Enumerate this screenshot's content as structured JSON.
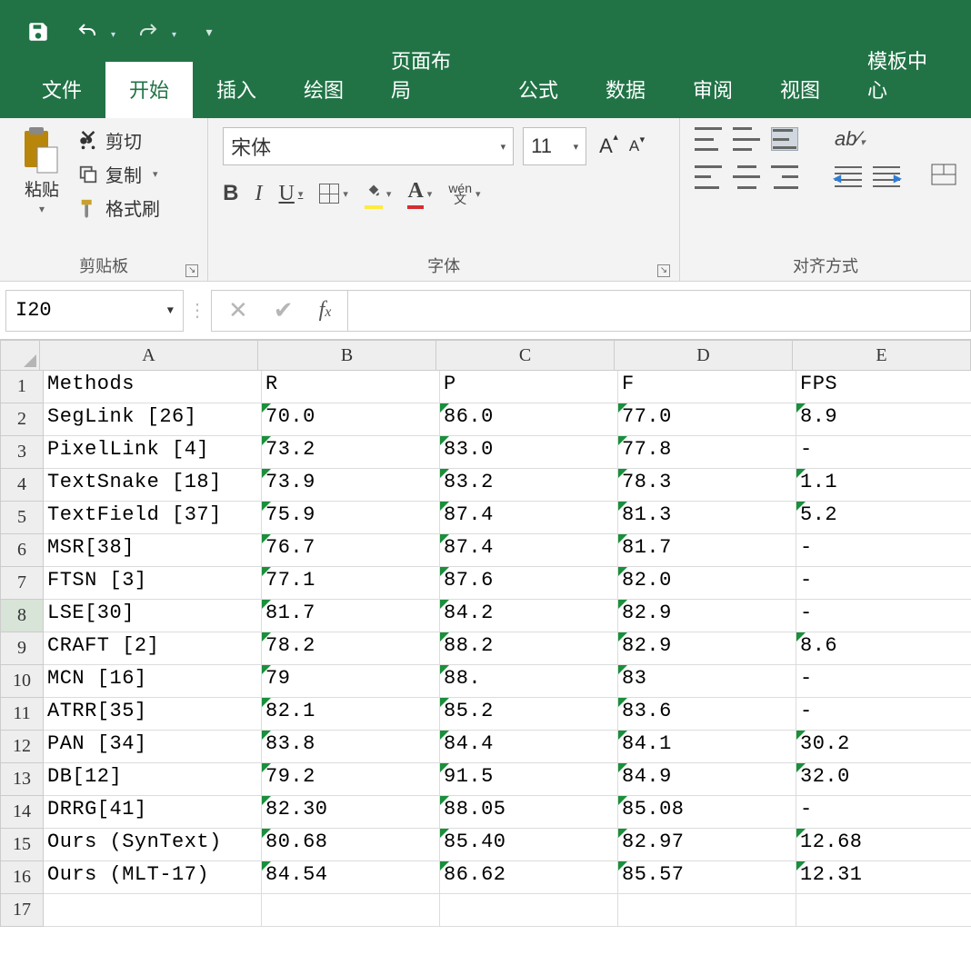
{
  "qat": {
    "save": "save",
    "undo": "undo",
    "redo": "redo"
  },
  "tabs": [
    "文件",
    "开始",
    "插入",
    "绘图",
    "页面布局",
    "公式",
    "数据",
    "审阅",
    "视图",
    "模板中心"
  ],
  "active_tab_index": 1,
  "ribbon": {
    "clipboard": {
      "label": "剪贴板",
      "paste": "粘贴",
      "cut": "剪切",
      "copy": "复制",
      "format_painter": "格式刷"
    },
    "font": {
      "label": "字体",
      "font_name": "宋体",
      "font_size": "11"
    },
    "align": {
      "label": "对齐方式"
    }
  },
  "name_box": "I20",
  "formula_value": "",
  "columns": [
    "A",
    "B",
    "C",
    "D",
    "E"
  ],
  "col_widths": [
    "cA",
    "cB",
    "cC",
    "cD",
    "cE"
  ],
  "row_count": 17,
  "selected_row": 8,
  "numeric_text_cols": [
    1,
    2,
    3,
    4
  ],
  "rows": [
    [
      "Methods",
      "R",
      "P",
      "F",
      "FPS"
    ],
    [
      "SegLink [26]",
      "70.0",
      "86.0",
      "77.0",
      "8.9"
    ],
    [
      "PixelLink [4]",
      "73.2",
      "83.0",
      "77.8",
      "-"
    ],
    [
      "TextSnake [18]",
      "73.9",
      "83.2",
      "78.3",
      "1.1"
    ],
    [
      "TextField [37]",
      "75.9",
      "87.4",
      "81.3",
      "5.2"
    ],
    [
      "MSR[38]",
      "76.7",
      "87.4",
      "81.7",
      "-"
    ],
    [
      "FTSN [3]",
      "77.1",
      "87.6",
      "82.0",
      "-"
    ],
    [
      "LSE[30]",
      "81.7",
      "84.2",
      "82.9",
      "-"
    ],
    [
      "CRAFT [2]",
      "78.2",
      "88.2",
      "82.9",
      "8.6"
    ],
    [
      "MCN [16]",
      "79",
      "88.",
      "83",
      "-"
    ],
    [
      "ATRR[35]",
      "82.1",
      "85.2",
      "83.6",
      "-"
    ],
    [
      "PAN [34]",
      "83.8",
      "84.4",
      "84.1",
      "30.2"
    ],
    [
      "DB[12]",
      "79.2",
      "91.5",
      "84.9",
      "32.0"
    ],
    [
      "DRRG[41]",
      "82.30",
      "88.05",
      "85.08",
      "-"
    ],
    [
      "Ours (SynText)",
      "80.68",
      "85.40",
      "82.97",
      "12.68"
    ],
    [
      "Ours (MLT-17)",
      "84.54",
      "86.62",
      "85.57",
      "12.31"
    ],
    [
      "",
      "",
      "",
      "",
      ""
    ]
  ],
  "chart_data": {
    "type": "table",
    "columns": [
      "Methods",
      "R",
      "P",
      "F",
      "FPS"
    ],
    "rows": [
      {
        "Methods": "SegLink [26]",
        "R": 70.0,
        "P": 86.0,
        "F": 77.0,
        "FPS": 8.9
      },
      {
        "Methods": "PixelLink [4]",
        "R": 73.2,
        "P": 83.0,
        "F": 77.8,
        "FPS": null
      },
      {
        "Methods": "TextSnake [18]",
        "R": 73.9,
        "P": 83.2,
        "F": 78.3,
        "FPS": 1.1
      },
      {
        "Methods": "TextField [37]",
        "R": 75.9,
        "P": 87.4,
        "F": 81.3,
        "FPS": 5.2
      },
      {
        "Methods": "MSR[38]",
        "R": 76.7,
        "P": 87.4,
        "F": 81.7,
        "FPS": null
      },
      {
        "Methods": "FTSN [3]",
        "R": 77.1,
        "P": 87.6,
        "F": 82.0,
        "FPS": null
      },
      {
        "Methods": "LSE[30]",
        "R": 81.7,
        "P": 84.2,
        "F": 82.9,
        "FPS": null
      },
      {
        "Methods": "CRAFT [2]",
        "R": 78.2,
        "P": 88.2,
        "F": 82.9,
        "FPS": 8.6
      },
      {
        "Methods": "MCN [16]",
        "R": 79,
        "P": 88,
        "F": 83,
        "FPS": null
      },
      {
        "Methods": "ATRR[35]",
        "R": 82.1,
        "P": 85.2,
        "F": 83.6,
        "FPS": null
      },
      {
        "Methods": "PAN [34]",
        "R": 83.8,
        "P": 84.4,
        "F": 84.1,
        "FPS": 30.2
      },
      {
        "Methods": "DB[12]",
        "R": 79.2,
        "P": 91.5,
        "F": 84.9,
        "FPS": 32.0
      },
      {
        "Methods": "DRRG[41]",
        "R": 82.3,
        "P": 88.05,
        "F": 85.08,
        "FPS": null
      },
      {
        "Methods": "Ours (SynText)",
        "R": 80.68,
        "P": 85.4,
        "F": 82.97,
        "FPS": 12.68
      },
      {
        "Methods": "Ours (MLT-17)",
        "R": 84.54,
        "P": 86.62,
        "F": 85.57,
        "FPS": 12.31
      }
    ]
  }
}
